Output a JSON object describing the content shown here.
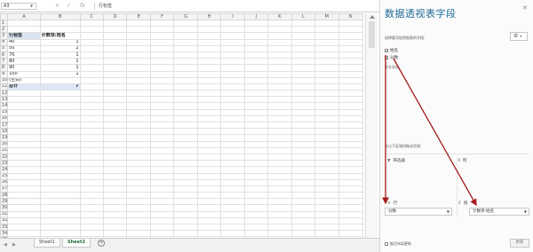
{
  "formula_bar": {
    "name_box": "A3",
    "controls": [
      "×",
      "✓",
      "fx"
    ],
    "value": "行标签"
  },
  "grid": {
    "columns": [
      "A",
      "B",
      "C",
      "D",
      "E",
      "F",
      "G",
      "H",
      "I",
      "J",
      "K",
      "L",
      "M",
      "N"
    ],
    "pivot_header": {
      "row_labels": "行标签",
      "count_label": "计数项:姓名"
    },
    "pivot_rows": [
      {
        "label": "40",
        "count": "1"
      },
      {
        "label": "50",
        "count": "2"
      },
      {
        "label": "70",
        "count": "1"
      },
      {
        "label": "80",
        "count": "1"
      },
      {
        "label": "90",
        "count": "1"
      },
      {
        "label": "100",
        "count": "1"
      },
      {
        "label": "(空白)",
        "count": ""
      }
    ],
    "total": {
      "label": "总计",
      "count": "7"
    }
  },
  "sheet_tabs": [
    "Sheet1",
    "Sheet2"
  ],
  "add_sheet_label": "+",
  "pivot_pane": {
    "title": "数据透视表字段",
    "subtitle": "选择要添加到报表的字段:",
    "fields": [
      {
        "label": "姓名",
        "checked": true
      },
      {
        "label": "分数",
        "checked": true
      }
    ],
    "more_tables": "更多表格...",
    "drag_hint": "在以下区域间拖动字段:",
    "filter_area": "筛选器",
    "columns_area": "列",
    "rows_area": "行",
    "values_area": "值",
    "rows_value": "分数",
    "values_value": "计数项:姓名",
    "defer_label": "推迟布局更新",
    "update_label": "更新"
  },
  "colors": {
    "annotation_arrow": "#a51c1c",
    "pane_title": "#1d6a96",
    "total_row": "#dde6f3"
  }
}
